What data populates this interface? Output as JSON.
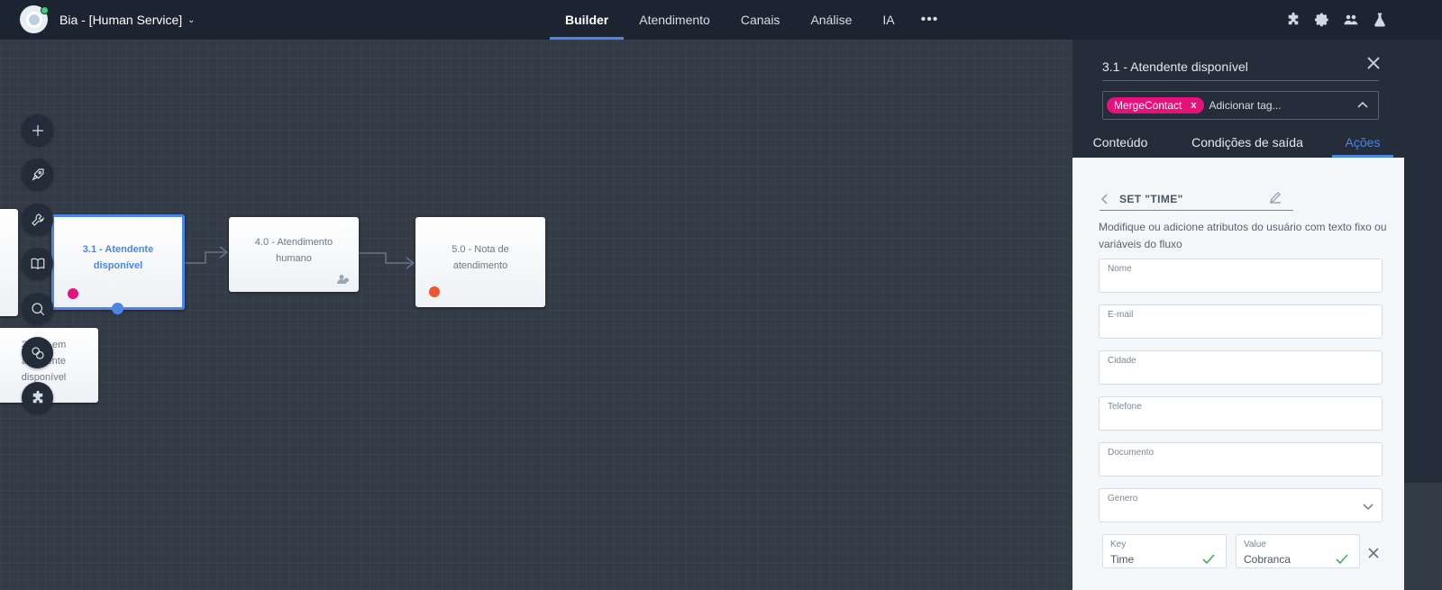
{
  "app": {
    "bot_name": "Bia - [Human Service]"
  },
  "nav": {
    "items": [
      "Builder",
      "Atendimento",
      "Canais",
      "Análise",
      "IA"
    ],
    "active": "Builder",
    "more": "•••"
  },
  "top_icons": [
    "puzzle-icon",
    "gear-icon",
    "team-icon",
    "flask-icon"
  ],
  "tools": [
    "plus-icon",
    "rocket-icon",
    "wrench-icon",
    "book-icon",
    "search-icon",
    "sync-icon",
    "puzzle-icon"
  ],
  "nodes": {
    "n31": {
      "label": "3.1 - Atendente disponível",
      "dot_color": "#e6117b"
    },
    "n40": {
      "label": "4.0 - Atendimento humano"
    },
    "n50": {
      "label": "5.0 - Nota de atendimento",
      "dot_color": "#f2542d"
    },
    "n32": {
      "label": "3.2 - ...em atendente disponível"
    }
  },
  "panel": {
    "title": "3.1 - Atendente disponível",
    "tag": "MergeContact",
    "tag_remove": "x",
    "tag_placeholder": "Adicionar tag...",
    "tabs": [
      "Conteúdo",
      "Condições de saída",
      "Ações"
    ],
    "active_tab": "Ações",
    "action_title": "SET \"TIME\"",
    "description": "Modifique ou adicione atributos do usuário com texto fixo ou variáveis do fluxo",
    "fields": [
      {
        "label": "Nome"
      },
      {
        "label": "E-mail"
      },
      {
        "label": "Cidade"
      },
      {
        "label": "Telefone"
      },
      {
        "label": "Documento"
      },
      {
        "label": "Genero"
      }
    ],
    "key_label": "Key",
    "key_value": "Time",
    "value_label": "Value",
    "value_value": "Cobranca"
  },
  "colors": {
    "accent": "#4a86e8",
    "topbar": "#1c2432",
    "canvas": "#333b47",
    "tag": "#e6117b"
  }
}
